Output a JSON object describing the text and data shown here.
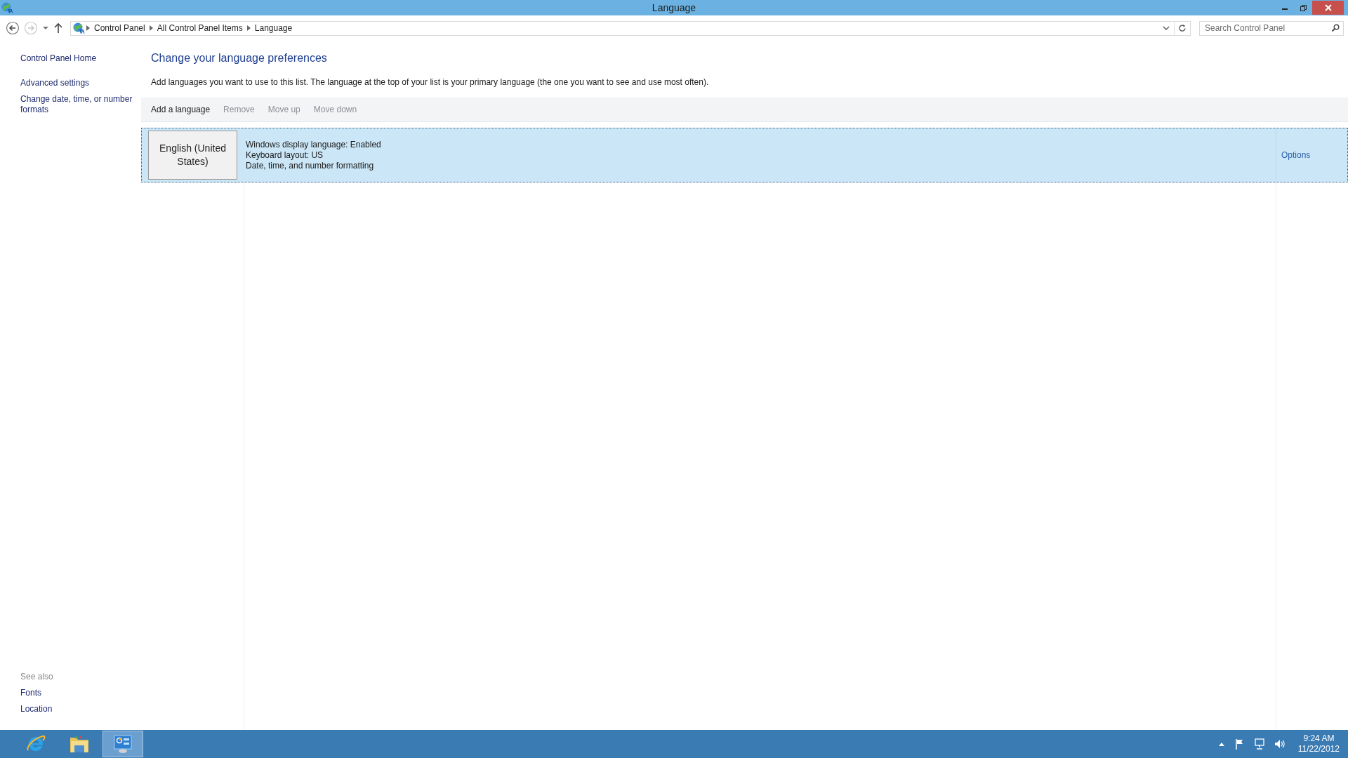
{
  "window": {
    "title": "Language"
  },
  "breadcrumb": [
    "Control Panel",
    "All Control Panel Items",
    "Language"
  ],
  "search": {
    "placeholder": "Search Control Panel"
  },
  "sidebar": {
    "links": [
      "Control Panel Home",
      "Advanced settings",
      "Change date, time, or number formats"
    ],
    "see_also_title": "See also",
    "see_also": [
      "Fonts",
      "Location"
    ]
  },
  "main": {
    "heading": "Change your language preferences",
    "description": "Add languages you want to use to this list. The language at the top of your list is your primary language (the one you want to see and use most often).",
    "toolbar": [
      {
        "label": "Add a language",
        "disabled": false
      },
      {
        "label": "Remove",
        "disabled": true
      },
      {
        "label": "Move up",
        "disabled": true
      },
      {
        "label": "Move down",
        "disabled": true
      }
    ],
    "languages": [
      {
        "name": "English (United States)",
        "details": [
          "Windows display language: Enabled",
          "Keyboard layout: US",
          "Date, time, and number formatting"
        ],
        "action": "Options",
        "selected": true
      }
    ]
  },
  "taskbar": {
    "apps": [
      {
        "kind": "browser",
        "selected": false
      },
      {
        "kind": "folder",
        "selected": false
      },
      {
        "kind": "control-panel",
        "selected": true
      }
    ],
    "time": "9:24 AM",
    "date": "11/22/2012"
  }
}
